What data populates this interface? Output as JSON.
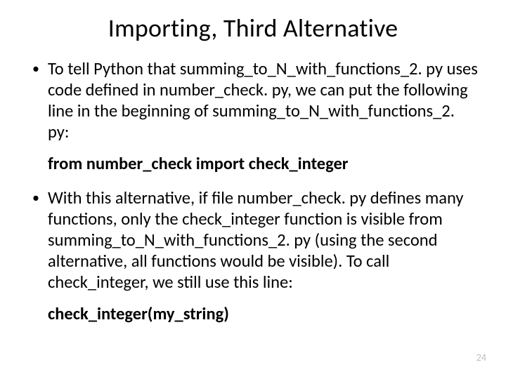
{
  "title": "Importing, Third Alternative",
  "bullets": {
    "b1": "To tell Python that summing_to_N_with_functions_2. py uses code defined in number_check. py, we can put the following line in the beginning of summing_to_N_with_functions_2. py:",
    "b2": "With this alternative, if file number_check. py defines many functions, only the check_integer function is visible from summing_to_N_with_functions_2. py (using the second alternative, all functions would be visible). To call check_integer, we still use this line:"
  },
  "code": {
    "line1": "from number_check import check_integer",
    "line2": "check_integer(my_string)"
  },
  "page_number": "24"
}
